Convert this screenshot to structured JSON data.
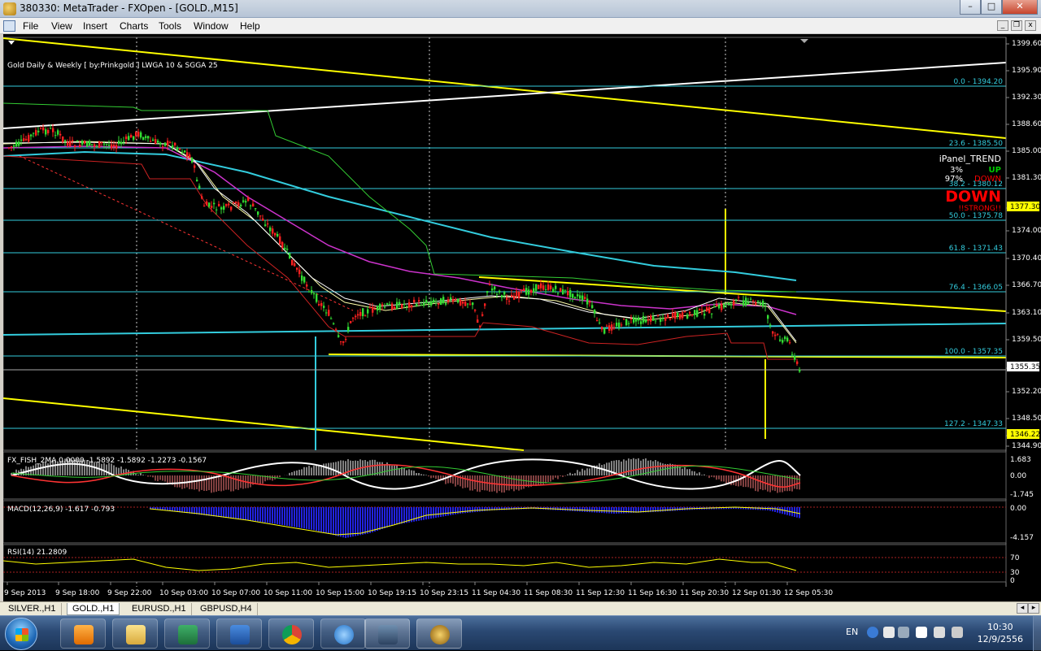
{
  "window": {
    "title": "380330: MetaTrader - FXOpen - [GOLD.,M15]"
  },
  "menu": [
    "File",
    "View",
    "Insert",
    "Charts",
    "Tools",
    "Window",
    "Help"
  ],
  "chart": {
    "header": "Gold Daily & Weekly [ by:Prinkgold ] LWGA 10  &  SGGA 25",
    "symbol": "GOLD.",
    "timeframe": "M15",
    "price_axis": [
      "1399.60",
      "1395.90",
      "1392.30",
      "1388.60",
      "1385.00",
      "1381.30",
      "1377.30",
      "1374.00",
      "1370.40",
      "1366.70",
      "1363.10",
      "1359.50",
      "1355.35",
      "1352.20",
      "1348.50",
      "1346.22",
      "1344.90"
    ],
    "current_price": "1355.35",
    "marker_price_1": "1377.30",
    "marker_price_2": "1346.22",
    "fib_levels": [
      {
        "label": "0.0 - 1394.20"
      },
      {
        "label": "23.6 - 1385.50"
      },
      {
        "label": "38.2 - 1380.12"
      },
      {
        "label": "50.0 - 1375.78"
      },
      {
        "label": "61.8 - 1371.43"
      },
      {
        "label": "76.4 - 1366.05"
      },
      {
        "label": "100.0 - 1357.35"
      },
      {
        "label": "127.2 - 1347.33"
      }
    ],
    "panel": {
      "title": "iPanel_TREND",
      "row1_pct": "3%",
      "row1_label": "UP",
      "row2_pct": "97%",
      "row2_label": "DOWN",
      "big_label": "DOWN",
      "strength": "!!STRONG!!",
      "colors": {
        "up": "#00cc00",
        "down": "#ff0000"
      }
    },
    "time_axis": [
      "9 Sep 2013",
      "9 Sep 18:00",
      "9 Sep 22:00",
      "10 Sep 03:00",
      "10 Sep 07:00",
      "10 Sep 11:00",
      "10 Sep 15:00",
      "10 Sep 19:15",
      "10 Sep 23:15",
      "11 Sep 04:30",
      "11 Sep 08:30",
      "11 Sep 12:30",
      "11 Sep 16:30",
      "11 Sep 20:30",
      "12 Sep 01:30",
      "12 Sep 05:30"
    ]
  },
  "indicators": {
    "fish": {
      "label": "FX_FISH_2MA 0.0000 -1.5892 -1.5892 -1.2273 -0.1567",
      "scale": [
        "1.683",
        "0.00",
        "-1.745"
      ]
    },
    "macd": {
      "label": "MACD(12,26,9) -1.617 -0.793",
      "scale": [
        "0.00",
        "-4.157"
      ]
    },
    "rsi": {
      "label": "RSI(14) 21.2809",
      "scale": [
        "70",
        "30",
        "0"
      ]
    }
  },
  "tabs": [
    "SILVER.,H1",
    "GOLD.,H1",
    "EURUSD.,H1",
    "GBPUSD,H4"
  ],
  "active_tab": "GOLD.,H1",
  "taskbar": {
    "lang": "EN",
    "time": "10:30",
    "date": "12/9/2556"
  }
}
